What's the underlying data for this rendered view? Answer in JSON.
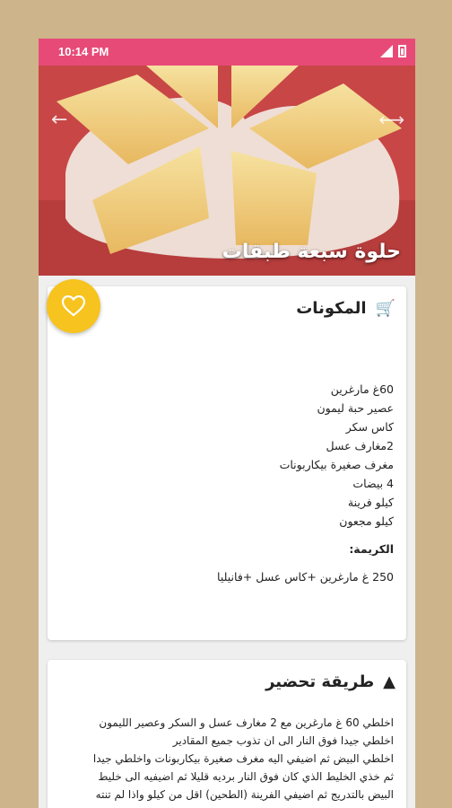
{
  "status_bar": {
    "time": "10:14 PM"
  },
  "recipe": {
    "title": "حلوة سبعة طبقات"
  },
  "ingredients": {
    "heading": "المكونات",
    "items": [
      "60غ مارغرين",
      "عصير حبة ليمون",
      "كاس سكر",
      "2مغارف عسل",
      "مغرف صغيرة بيكاربونات",
      "4 بيضات",
      "كيلو فرينة",
      "كيلو مجعون"
    ],
    "cream_heading": "الكريمة:",
    "cream_items": [
      "250 غ مارغرين +كاس عسل +فانيليا"
    ]
  },
  "preparation": {
    "heading": "طريقة تحضير",
    "lines": [
      "اخلطي 60 غ مارغرين مع 2 مغارف عسل و السكر وعصير الليمون",
      "اخلطي جيدا فوق النار الى ان تذوب جميع المقادير",
      "اخلطي البيض ثم اضيفي اليه مغرف صغيرة بيكاربونات واخلطي جيدا",
      "ثم خذي الخليط الذي كان فوق النار برديه قليلا ثم اضيفيه الى خليط",
      "البيض بالتدريج ثم اضيفي الفرينة (الطحين) اقل من كيلو واذا لم تنته"
    ]
  },
  "icons": {
    "favorite": "heart-outline-icon",
    "ingredients": "basket-icon",
    "preparation": "cloche-icon",
    "back": "back-arrow-icon",
    "share": "share-icon"
  },
  "colors": {
    "status_bar": "#e84a78",
    "fab": "#f7c31e",
    "background": "#efefef"
  }
}
